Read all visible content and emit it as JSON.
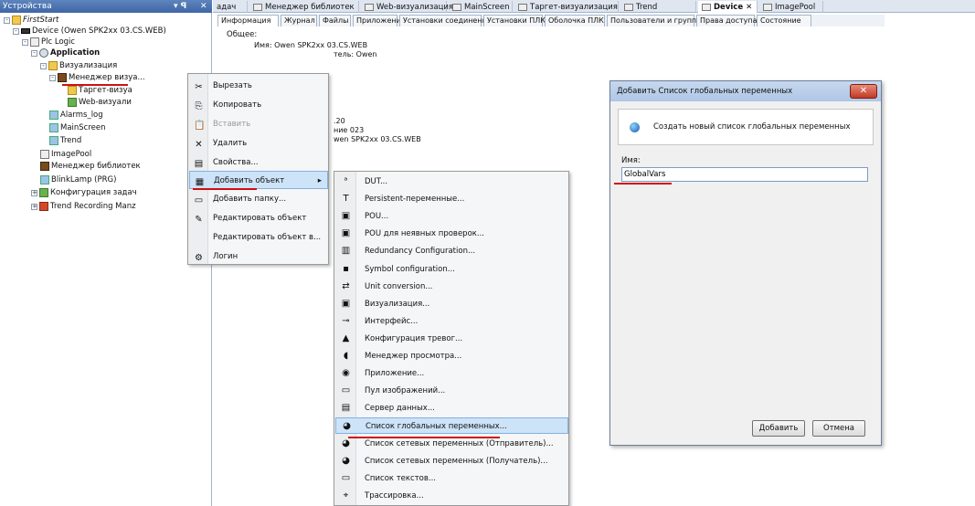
{
  "devices_panel": {
    "title": "Устройства",
    "pin": "▾ ꟼ",
    "close": "✕",
    "tree": [
      {
        "label": "FirstStart",
        "italic": true
      },
      {
        "label": "Device (Owen SPK2xx 03.CS.WEB)"
      },
      {
        "label": "Plc Logic"
      },
      {
        "label": "Application",
        "bold": true
      },
      {
        "label": "Визуализация"
      },
      {
        "label": "Менеджер визуа..."
      },
      {
        "label": "Таргет-визуа"
      },
      {
        "label": "Web-визуали"
      },
      {
        "label": "Alarms_log"
      },
      {
        "label": "MainScreen"
      },
      {
        "label": "Trend"
      },
      {
        "label": "ImagePool"
      },
      {
        "label": "Менеджер библиотек"
      },
      {
        "label": "BlinkLamp (PRG)"
      },
      {
        "label": "Конфигурация задач"
      },
      {
        "label": "Trend Recording Manz"
      }
    ]
  },
  "doc_tabs": [
    {
      "label": "адач"
    },
    {
      "label": "Менеджер библиотек"
    },
    {
      "label": "Web-визуализация"
    },
    {
      "label": "MainScreen"
    },
    {
      "label": "Таргет-визуализация"
    },
    {
      "label": "Trend"
    },
    {
      "label": "Device",
      "active": true
    },
    {
      "label": "ImagePool"
    }
  ],
  "sub_tabs": [
    "Информация",
    "Журнал",
    "Файлы",
    "Приложения",
    "Установки соединения",
    "Установки ПЛК",
    "Оболочка ПЛК",
    "Пользователи и группы",
    "Права доступа",
    "Состояние"
  ],
  "info": {
    "general_label": "Общее:",
    "name_line": "Имя: Owen SPK2xx 03.CS.WEB",
    "vendor_line": "тель: Owen",
    "line3": ".20",
    "line4": "ние 023",
    "line5": "wen SPK2xx 03.CS.WEB"
  },
  "context_menu": [
    {
      "label": "Вырезать",
      "icon": "cut-icon",
      "glyph": "✂"
    },
    {
      "label": "Копировать",
      "icon": "copy-icon",
      "glyph": "⎘"
    },
    {
      "label": "Вставить",
      "icon": "paste-icon",
      "glyph": "📋",
      "disabled": true
    },
    {
      "label": "Удалить",
      "icon": "delete-icon",
      "glyph": "✕"
    },
    {
      "label": "Свойства...",
      "icon": "properties-icon",
      "glyph": "▤"
    },
    {
      "label": "Добавить объект",
      "icon": "add-object-icon",
      "glyph": "▦",
      "highlighted": true,
      "submenu": true
    },
    {
      "label": "Добавить папку...",
      "icon": "folder-icon",
      "glyph": "▭"
    },
    {
      "label": "Редактировать объект",
      "icon": "edit-icon",
      "glyph": "✎"
    },
    {
      "label": "Редактировать объект в...",
      "icon": "edit-in-icon",
      "glyph": ""
    },
    {
      "label": "Логин",
      "icon": "login-icon",
      "glyph": "⚙"
    }
  ],
  "submenu": [
    {
      "label": "DUT...",
      "icon": "dut-icon",
      "glyph": "ᵃ"
    },
    {
      "label": "Persistent-переменные...",
      "icon": "persistent-icon",
      "glyph": "T"
    },
    {
      "label": "POU...",
      "icon": "pou-icon",
      "glyph": "▣"
    },
    {
      "label": "POU для неявных проверок...",
      "icon": "pou-check-icon",
      "glyph": "▣"
    },
    {
      "label": "Redundancy Configuration...",
      "icon": "redundancy-icon",
      "glyph": "▥"
    },
    {
      "label": "Symbol configuration...",
      "icon": "symbol-icon",
      "glyph": "▪"
    },
    {
      "label": "Unit conversion...",
      "icon": "unit-icon",
      "glyph": "⇄"
    },
    {
      "label": "Визуализация...",
      "icon": "visualization-icon",
      "glyph": "▣"
    },
    {
      "label": "Интерфейс...",
      "icon": "interface-icon",
      "glyph": "⊸"
    },
    {
      "label": "Конфигурация тревог...",
      "icon": "alarm-icon",
      "glyph": "▲"
    },
    {
      "label": "Менеджер просмотра...",
      "icon": "view-manager-icon",
      "glyph": "◖"
    },
    {
      "label": "Приложение...",
      "icon": "application-icon",
      "glyph": "◉"
    },
    {
      "label": "Пул изображений...",
      "icon": "image-pool-icon",
      "glyph": "▭"
    },
    {
      "label": "Сервер данных...",
      "icon": "data-server-icon",
      "glyph": "▤"
    },
    {
      "label": "Список глобальных переменных...",
      "icon": "globe-icon",
      "glyph": "◕",
      "highlighted": true
    },
    {
      "label": "Список сетевых переменных (Отправитель)...",
      "icon": "globe-icon",
      "glyph": "◕"
    },
    {
      "label": "Список сетевых переменных (Получатель)...",
      "icon": "globe-icon",
      "glyph": "◕"
    },
    {
      "label": "Список текстов...",
      "icon": "text-list-icon",
      "glyph": "▭"
    },
    {
      "label": "Трассировка...",
      "icon": "trace-icon",
      "glyph": "⌖"
    }
  ],
  "dialog": {
    "title": "Добавить Список глобальных переменных",
    "close": "✕",
    "description": "Создать новый список глобальных переменных",
    "name_label": "Имя:",
    "name_value": "GlobalVars",
    "add_button": "Добавить",
    "cancel_button": "Отмена"
  },
  "colors": {
    "underline": "#d01010",
    "highlight": "#cde3f8",
    "titlebar": "#3f67a6"
  }
}
